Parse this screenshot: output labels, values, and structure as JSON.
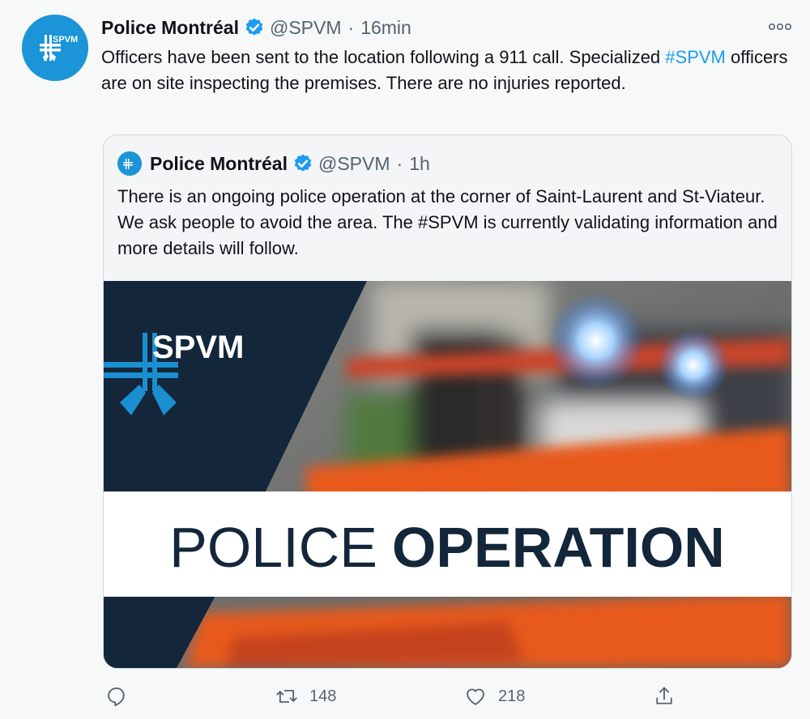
{
  "tweet": {
    "author_name": "Police Montréal",
    "handle": "@SPVM",
    "separator": "·",
    "time": "16min",
    "text_before": "Officers have been sent to the location following a 911 call. Specialized ",
    "hashtag": "#SPVM",
    "text_after": " officers are on site inspecting the premises. There are no injuries reported.",
    "avatar_logo_text": "SPVM"
  },
  "quoted": {
    "author_name": "Police Montréal",
    "handle": "@SPVM",
    "separator": "·",
    "time": "1h",
    "text": "There is an ongoing police operation at the corner of Saint-Laurent and St-Viateur. We ask people to avoid the area. The #SPVM is currently validating information and more details will follow.",
    "image": {
      "logo_text": "SPVM",
      "banner_light": "POLICE",
      "banner_bold": "OPERATION"
    }
  },
  "actions": {
    "reply_icon": "reply-icon",
    "retweet_icon": "retweet-icon",
    "retweet_count": "148",
    "like_icon": "heart-icon",
    "like_count": "218",
    "share_icon": "share-icon"
  },
  "colors": {
    "brand_blue": "#1b95d8",
    "link_blue": "#1d9bf0",
    "navy": "#13263a",
    "muted": "#536471",
    "tape_orange": "#e85a1d"
  }
}
